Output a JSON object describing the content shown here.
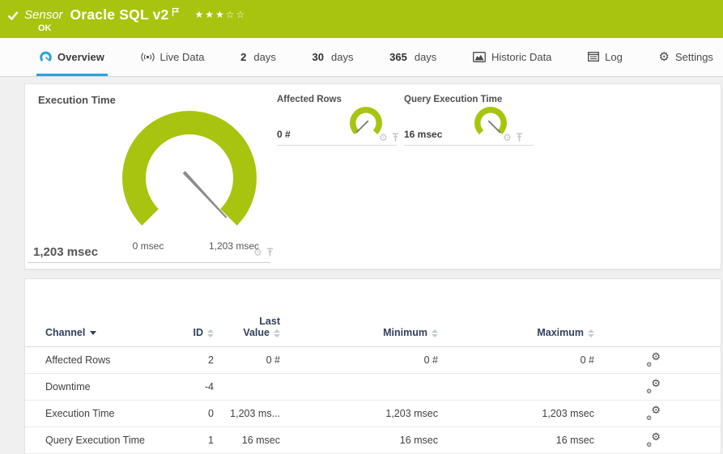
{
  "header": {
    "kind_label": "Sensor",
    "sensor_name": "Oracle SQL v2",
    "status": "OK",
    "stars": "★★★☆☆",
    "rating_filled": 3,
    "rating_total": 5
  },
  "tabs": [
    {
      "label": "Overview",
      "icon": "gauge-icon",
      "active": true
    },
    {
      "label": "Live Data",
      "icon": "broadcast-icon",
      "active": false
    },
    {
      "num": "2",
      "label": "days",
      "active": false
    },
    {
      "num": "30",
      "label": "days",
      "active": false
    },
    {
      "num": "365",
      "label": "days",
      "active": false
    },
    {
      "label": "Historic Data",
      "icon": "area-chart-icon",
      "active": false
    },
    {
      "label": "Log",
      "icon": "log-icon",
      "active": false
    },
    {
      "label": "Settings",
      "icon": "gear-icon",
      "active": false
    }
  ],
  "gauges": {
    "main": {
      "title": "Execution Time",
      "value": "1,203 msec",
      "min_label": "0 msec",
      "max_label": "1,203 msec",
      "needle_position": "max"
    },
    "small": [
      {
        "title": "Affected Rows",
        "value": "0 #",
        "needle_position": "min"
      },
      {
        "title": "Query Execution Time",
        "value": "16 msec",
        "needle_position": "max"
      }
    ]
  },
  "table": {
    "columns": {
      "channel": "Channel",
      "id": "ID",
      "last_line1": "Last",
      "last_line2": "Value",
      "min": "Minimum",
      "max": "Maximum"
    },
    "sorted_by": "Channel",
    "sort_direction": "asc",
    "rows": [
      {
        "channel": "Affected Rows",
        "id": "2",
        "last": "0 #",
        "min": "0 #",
        "max": "0 #"
      },
      {
        "channel": "Downtime",
        "id": "-4",
        "last": "",
        "min": "",
        "max": ""
      },
      {
        "channel": "Execution Time",
        "id": "0",
        "last": "1,203 ms...",
        "min": "1,203 msec",
        "max": "1,203 msec"
      },
      {
        "channel": "Query Execution Time",
        "id": "1",
        "last": "16 msec",
        "min": "16 msec",
        "max": "16 msec"
      }
    ]
  },
  "colors": {
    "header_green": "#a9c40f",
    "gauge_green": "#a9c40f",
    "active_tab_blue": "#2aa2da",
    "table_header_navy": "#31405c",
    "needle_gray": "#8c8c8c"
  }
}
